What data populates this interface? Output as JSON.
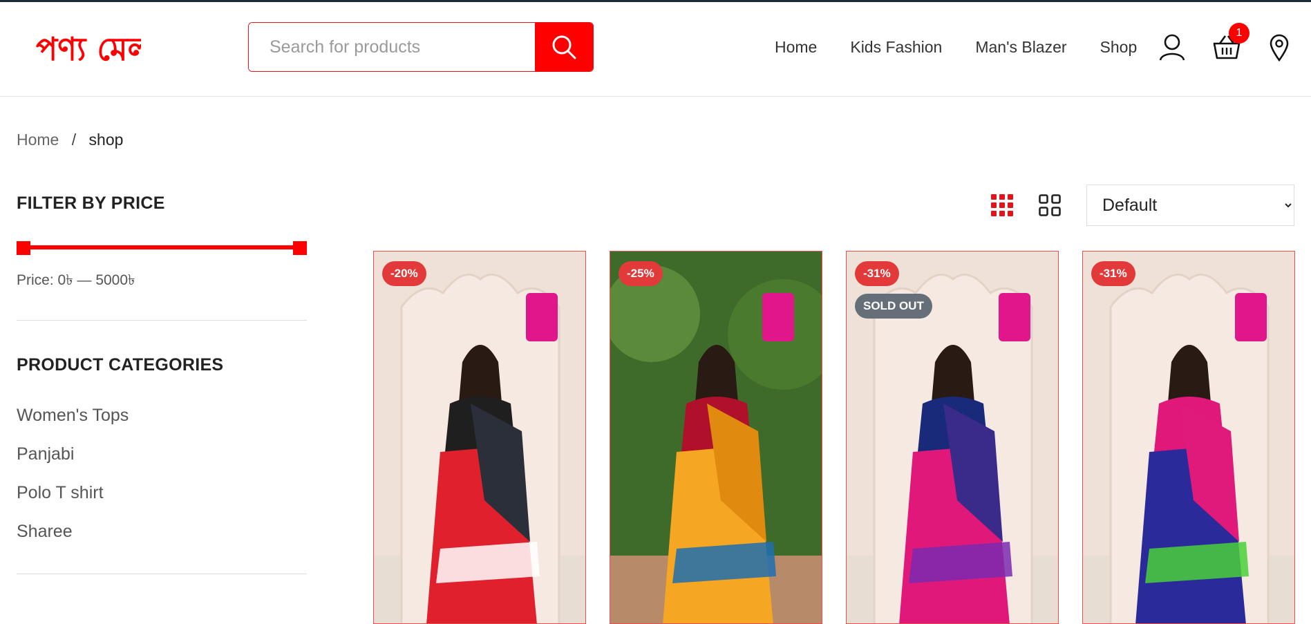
{
  "brand": {
    "logo_text": "পণ্য মেলা",
    "accent_color": "#ff0000",
    "logo_icon": "brand-logo"
  },
  "header": {
    "search": {
      "placeholder": "Search for products",
      "icon": "search-icon"
    },
    "nav": [
      "Home",
      "Kids Fashion",
      "Man's Blazer",
      "Shop"
    ],
    "account_icon": "user-icon",
    "cart_icon": "basket-icon",
    "cart_count": "1",
    "location_icon": "map-pin-icon"
  },
  "breadcrumb": {
    "home": "Home",
    "separator": "/",
    "current": "shop"
  },
  "sidebar": {
    "price_filter": {
      "title": "FILTER BY PRICE",
      "label": "Price: 0৳ — 5000৳",
      "range_min": 0,
      "range_max": 5000
    },
    "categories": {
      "title": "PRODUCT CATEGORIES",
      "items": [
        "Women's Tops",
        "Panjabi",
        "Polo T shirt",
        "Sharee"
      ]
    }
  },
  "toolbar": {
    "grid_small_icon": "grid-3x3-icon",
    "grid_large_icon": "grid-2x2-icon",
    "sort_options": [
      "Default"
    ],
    "sort_selected": "Default"
  },
  "products": [
    {
      "discount": "-20%",
      "sold_out": "",
      "sharee_colors": [
        "#e0202c",
        "#2a2f3a",
        "#ffffff"
      ],
      "blouse": "#1f1f1f"
    },
    {
      "discount": "-25%",
      "sold_out": "",
      "sharee_colors": [
        "#f5a623",
        "#e08a10",
        "#1e6fb0"
      ],
      "blouse": "#b0102a"
    },
    {
      "discount": "-31%",
      "sold_out": "SOLD OUT",
      "sharee_colors": [
        "#e0187a",
        "#3a2a8a",
        "#7a2ab0"
      ],
      "blouse": "#1a2a7a"
    },
    {
      "discount": "-31%",
      "sold_out": "",
      "sharee_colors": [
        "#2a2a9a",
        "#e01a7a",
        "#4ad03a"
      ],
      "blouse": "#e0187a"
    }
  ]
}
